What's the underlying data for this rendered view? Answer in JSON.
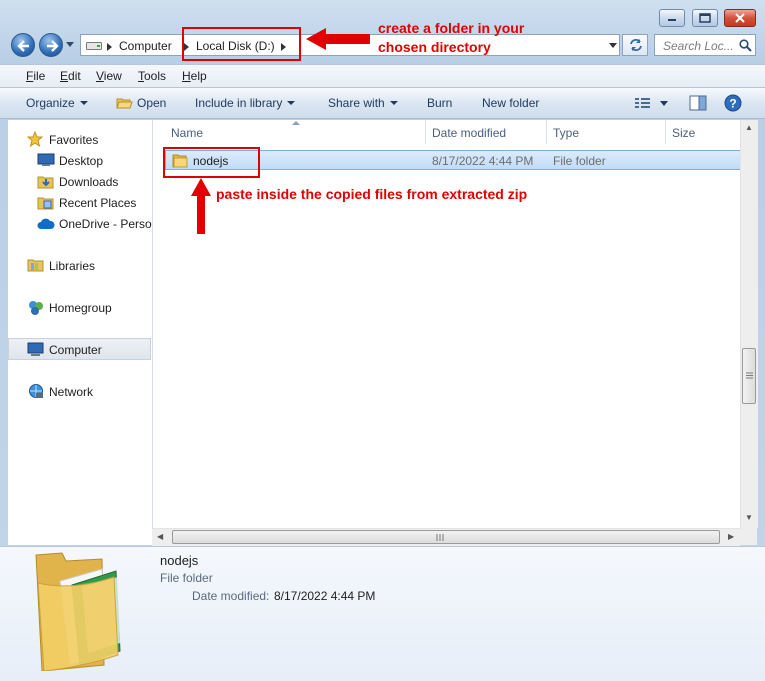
{
  "address": {
    "breadcrumbs": [
      "Computer",
      "Local Disk (D:)"
    ],
    "search_placeholder": "Search Loc..."
  },
  "menu": [
    {
      "label": "File",
      "key": "F",
      "rest": "ile"
    },
    {
      "label": "Edit",
      "key": "E",
      "rest": "dit"
    },
    {
      "label": "View",
      "key": "V",
      "rest": "iew"
    },
    {
      "label": "Tools",
      "key": "T",
      "rest": "ools"
    },
    {
      "label": "Help",
      "key": "H",
      "rest": "elp"
    }
  ],
  "toolbar": {
    "organize": "Organize",
    "open": "Open",
    "include": "Include in library",
    "share": "Share with",
    "burn": "Burn",
    "new_folder": "New folder"
  },
  "nav": {
    "favorites": "Favorites",
    "desktop": "Desktop",
    "downloads": "Downloads",
    "recent": "Recent Places",
    "onedrive": "OneDrive - Persor",
    "libraries": "Libraries",
    "homegroup": "Homegroup",
    "computer": "Computer",
    "network": "Network"
  },
  "columns": {
    "name": "Name",
    "date": "Date modified",
    "type": "Type",
    "size": "Size"
  },
  "files": [
    {
      "name": "nodejs",
      "date": "8/17/2022 4:44 PM",
      "type": "File folder"
    }
  ],
  "details": {
    "name": "nodejs",
    "type": "File folder",
    "date_label": "Date modified:",
    "date_value": "8/17/2022 4:44 PM"
  },
  "annotations": {
    "folder_note_line1": "create a folder in your",
    "folder_note_line2": "chosen directory",
    "paste_note": "paste inside the copied files from extracted zip"
  },
  "colors": {
    "annotation": "#e00000",
    "selection": "#c1dcf8"
  }
}
